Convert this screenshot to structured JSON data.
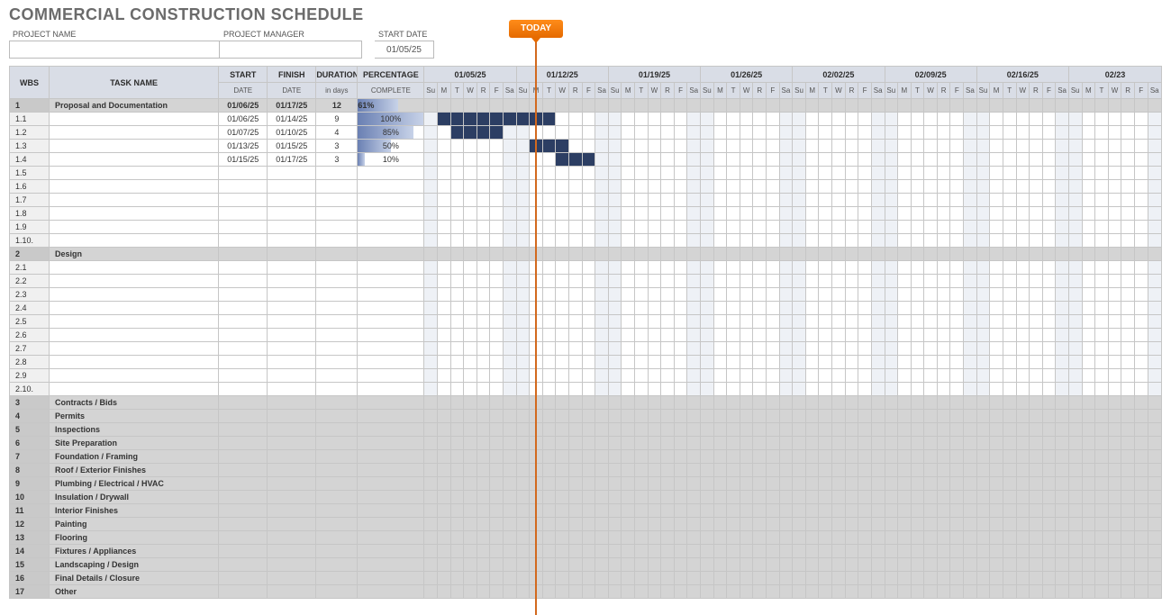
{
  "title": "COMMERCIAL CONSTRUCTION SCHEDULE",
  "meta": {
    "project_name_label": "PROJECT NAME",
    "project_manager_label": "PROJECT MANAGER",
    "start_date_label": "START DATE",
    "start_date_value": "01/05/25"
  },
  "today_label": "TODAY",
  "today_col_index": 8,
  "headers": {
    "wbs": "WBS",
    "task": "TASK NAME",
    "start": "START",
    "start_sub": "DATE",
    "finish": "FINISH",
    "finish_sub": "DATE",
    "dur": "DURATION",
    "dur_sub": "in days",
    "pct": "PERCENTAGE",
    "pct_sub": "COMPLETE"
  },
  "weeks": [
    "01/05/25",
    "01/12/25",
    "01/19/25",
    "01/26/25",
    "02/02/25",
    "02/09/25",
    "02/16/25",
    "02/23"
  ],
  "day_letters": [
    "Su",
    "M",
    "T",
    "W",
    "R",
    "F",
    "Sa"
  ],
  "weekend_offsets": [
    0,
    6
  ],
  "rows": [
    {
      "type": "phase",
      "wbs": "1",
      "task": "Proposal and Documentation",
      "start": "01/06/25",
      "finish": "01/17/25",
      "dur": "12",
      "pct": 61
    },
    {
      "type": "task",
      "wbs": "1.1",
      "task": "",
      "start": "01/06/25",
      "finish": "01/14/25",
      "dur": "9",
      "pct": 100,
      "bar_start": 1,
      "bar_end": 9
    },
    {
      "type": "task",
      "wbs": "1.2",
      "task": "",
      "start": "01/07/25",
      "finish": "01/10/25",
      "dur": "4",
      "pct": 85,
      "bar_start": 2,
      "bar_end": 5
    },
    {
      "type": "task",
      "wbs": "1.3",
      "task": "",
      "start": "01/13/25",
      "finish": "01/15/25",
      "dur": "3",
      "pct": 50,
      "bar_start": 8,
      "bar_end": 10
    },
    {
      "type": "task",
      "wbs": "1.4",
      "task": "",
      "start": "01/15/25",
      "finish": "01/17/25",
      "dur": "3",
      "pct": 10,
      "bar_start": 10,
      "bar_end": 12
    },
    {
      "type": "task",
      "wbs": "1.5"
    },
    {
      "type": "task",
      "wbs": "1.6"
    },
    {
      "type": "task",
      "wbs": "1.7"
    },
    {
      "type": "task",
      "wbs": "1.8"
    },
    {
      "type": "task",
      "wbs": "1.9"
    },
    {
      "type": "task",
      "wbs": "1.10."
    },
    {
      "type": "phase",
      "wbs": "2",
      "task": "Design"
    },
    {
      "type": "task",
      "wbs": "2.1"
    },
    {
      "type": "task",
      "wbs": "2.2"
    },
    {
      "type": "task",
      "wbs": "2.3"
    },
    {
      "type": "task",
      "wbs": "2.4"
    },
    {
      "type": "task",
      "wbs": "2.5"
    },
    {
      "type": "task",
      "wbs": "2.6"
    },
    {
      "type": "task",
      "wbs": "2.7"
    },
    {
      "type": "task",
      "wbs": "2.8"
    },
    {
      "type": "task",
      "wbs": "2.9"
    },
    {
      "type": "task",
      "wbs": "2.10."
    },
    {
      "type": "phase",
      "wbs": "3",
      "task": "Contracts / Bids"
    },
    {
      "type": "phase",
      "wbs": "4",
      "task": "Permits"
    },
    {
      "type": "phase",
      "wbs": "5",
      "task": "Inspections"
    },
    {
      "type": "phase",
      "wbs": "6",
      "task": "Site Preparation"
    },
    {
      "type": "phase",
      "wbs": "7",
      "task": "Foundation / Framing"
    },
    {
      "type": "phase",
      "wbs": "8",
      "task": "Roof / Exterior Finishes"
    },
    {
      "type": "phase",
      "wbs": "9",
      "task": "Plumbing / Electrical / HVAC"
    },
    {
      "type": "phase",
      "wbs": "10",
      "task": "Insulation / Drywall"
    },
    {
      "type": "phase",
      "wbs": "11",
      "task": "Interior Finishes"
    },
    {
      "type": "phase",
      "wbs": "12",
      "task": "Painting"
    },
    {
      "type": "phase",
      "wbs": "13",
      "task": "Flooring"
    },
    {
      "type": "phase",
      "wbs": "14",
      "task": "Fixtures / Appliances"
    },
    {
      "type": "phase",
      "wbs": "15",
      "task": "Landscaping / Design"
    },
    {
      "type": "phase",
      "wbs": "16",
      "task": "Final Details / Closure"
    },
    {
      "type": "phase",
      "wbs": "17",
      "task": "Other"
    }
  ]
}
